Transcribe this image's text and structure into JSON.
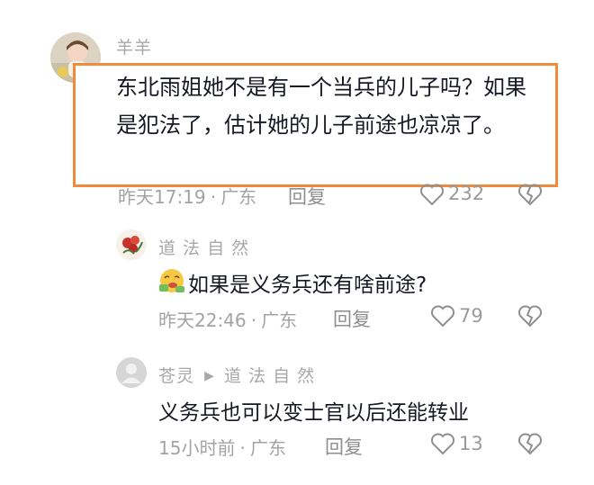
{
  "colors": {
    "highlight_border": "#f08a3c",
    "meta_text": "#a3a3a3",
    "body_text": "#161823"
  },
  "comments": [
    {
      "username": "羊羊",
      "text": "东北雨姐她不是有一个当兵的儿子吗？如果是犯法了，估计她的儿子前途也凉凉了。",
      "time": "昨天17:19",
      "location": "广东",
      "reply_label": "回复",
      "likes": "232",
      "avatar_icon": "child-photo-avatar"
    },
    {
      "username": "道 法 自 然",
      "emoji_icon": "money-mouth-emoji-icon",
      "text": "如果是义务兵还有啥前途?",
      "time": "昨天22:46",
      "location": "广东",
      "reply_label": "回复",
      "likes": "79",
      "avatar_icon": "flower-avatar"
    },
    {
      "username": "苍灵",
      "reply_to": "道 法 自 然",
      "text": "义务兵也可以变士官以后还能转业",
      "time": "15小时前",
      "location": "广东",
      "reply_label": "回复",
      "likes": "13",
      "avatar_icon": "default-user-avatar"
    }
  ],
  "separator": "·"
}
